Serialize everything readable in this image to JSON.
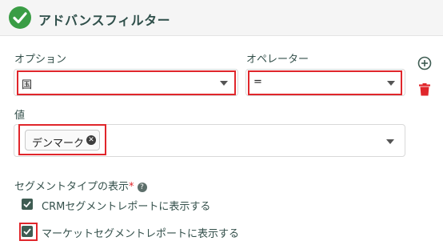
{
  "header": {
    "title": "アドバンスフィルター",
    "icon": "check-circle-icon",
    "accent": "#3a9d45"
  },
  "fields": {
    "option": {
      "label": "オプション",
      "value": "国"
    },
    "operator": {
      "label": "オペレーター",
      "value": "="
    },
    "value": {
      "label": "値",
      "chip": "デンマーク"
    }
  },
  "segment": {
    "label": "セグメントタイプの表示",
    "required_mark": "*",
    "help_icon": "?",
    "options": [
      {
        "label": "CRMセグメントレポートに表示する",
        "checked": true
      },
      {
        "label": "マーケットセグメントレポートに表示する",
        "checked": true
      }
    ]
  },
  "actions": {
    "add_icon": "plus-circle-icon",
    "delete_icon": "trash-icon",
    "delete_color": "#e0262b"
  },
  "highlight_color": "#e0262b"
}
